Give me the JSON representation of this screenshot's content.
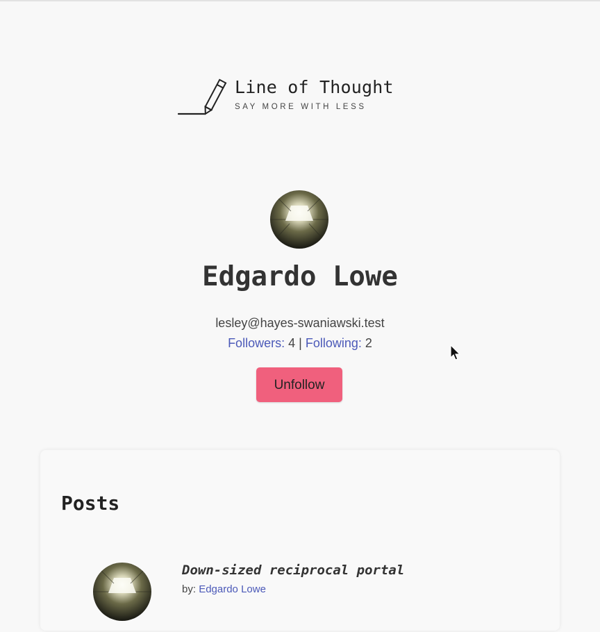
{
  "brand": {
    "title": "Line of Thought",
    "tagline": "SAY MORE WITH LESS",
    "logo_icon": "pencil-line-icon"
  },
  "profile": {
    "name": "Edgardo Lowe",
    "email": "lesley@hayes-swaniawski.test",
    "followers_label": "Followers:",
    "followers_count": "4",
    "separator": "|",
    "following_label": "Following:",
    "following_count": "2",
    "unfollow_label": "Unfollow"
  },
  "posts": {
    "heading": "Posts",
    "items": [
      {
        "title": "Down-sized reciprocal portal",
        "by_label": "by:",
        "author": "Edgardo Lowe"
      }
    ]
  },
  "colors": {
    "accent_link": "#4b59b8",
    "unfollow_button": "#f0607d",
    "background": "#f8f8f8"
  }
}
